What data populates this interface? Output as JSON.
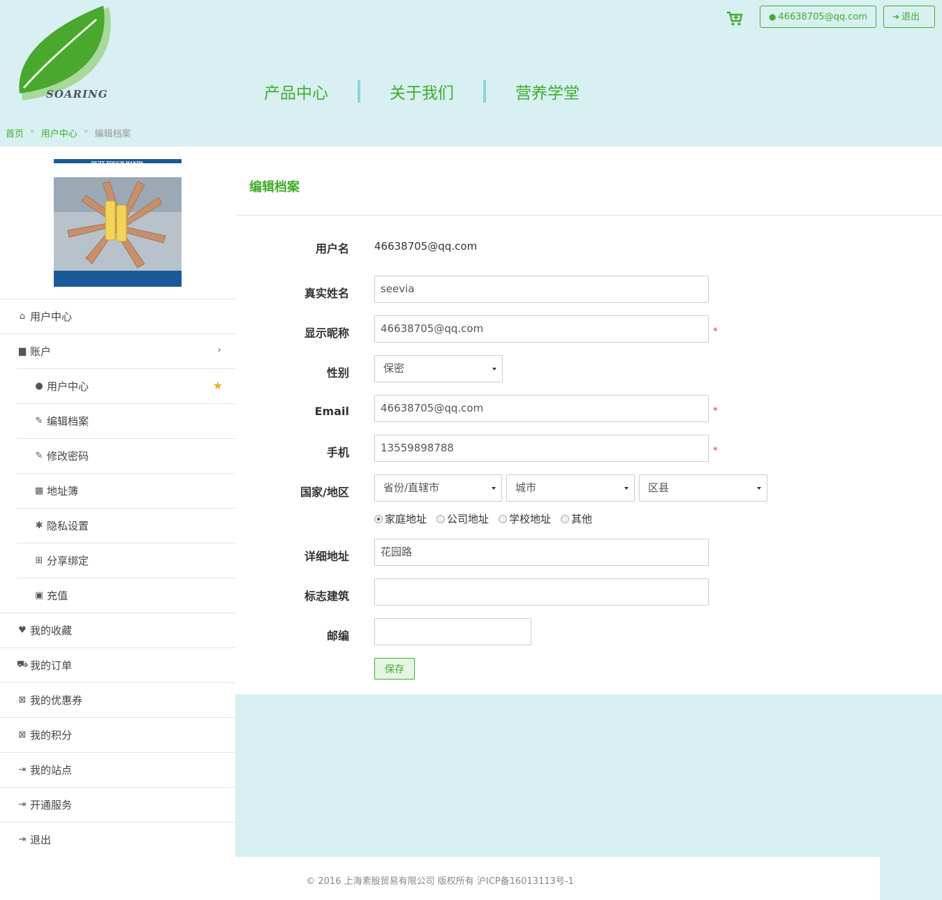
{
  "header": {
    "logo_text": "SOARING",
    "user_button": "46638705@qq.com",
    "logout_button": "退出",
    "nav": [
      "产品中心",
      "关于我们",
      "营养学堂"
    ]
  },
  "breadcrumb": {
    "home": "首页",
    "user_center": "用户中心",
    "current": "编辑档案",
    "separator": "»"
  },
  "promo": {
    "banner_text": "DUTT TOUGH HANDS"
  },
  "sidebar": {
    "items": [
      {
        "label": "用户中心",
        "icon": "home-icon",
        "glyph": "⌂"
      },
      {
        "label": "账户",
        "icon": "file-icon",
        "glyph": "▆"
      },
      {
        "label": "用户中心",
        "icon": "user-icon",
        "glyph": "●"
      },
      {
        "label": "编辑档案",
        "icon": "edit-icon",
        "glyph": "✎"
      },
      {
        "label": "修改密码",
        "icon": "edit-icon",
        "glyph": "✎"
      },
      {
        "label": "地址簿",
        "icon": "grid-icon",
        "glyph": "▦"
      },
      {
        "label": "隐私设置",
        "icon": "bug-icon",
        "glyph": "✱"
      },
      {
        "label": "分享绑定",
        "icon": "share-icon",
        "glyph": "⊞"
      },
      {
        "label": "充值",
        "icon": "money-icon",
        "glyph": "▣"
      },
      {
        "label": "我的收藏",
        "icon": "heart-icon",
        "glyph": "♥"
      },
      {
        "label": "我的订单",
        "icon": "cart-icon",
        "glyph": "⛟"
      },
      {
        "label": "我的优惠券",
        "icon": "gift-icon",
        "glyph": "⊠"
      },
      {
        "label": "我的积分",
        "icon": "gift-icon",
        "glyph": "⊠"
      },
      {
        "label": "我的站点",
        "icon": "sign-out-icon",
        "glyph": "⇥"
      },
      {
        "label": "开通服务",
        "icon": "sign-out-icon",
        "glyph": "⇥"
      },
      {
        "label": "退出",
        "icon": "sign-out-icon",
        "glyph": "⇥"
      }
    ]
  },
  "form": {
    "title": "编辑档案",
    "username_label": "用户名",
    "username_value": "46638705@qq.com",
    "realname_label": "真实姓名",
    "realname_value": "seevia",
    "nickname_label": "显示昵称",
    "nickname_value": "46638705@qq.com",
    "gender_label": "性别",
    "gender_value": "保密",
    "email_label": "Email",
    "email_value": "46638705@qq.com",
    "phone_label": "手机",
    "phone_value": "13559898788",
    "region_label": "国家/地区",
    "province": "省份/直辖市",
    "city": "城市",
    "district": "区县",
    "address_types": [
      "家庭地址",
      "公司地址",
      "学校地址",
      "其他"
    ],
    "address_label": "详细地址",
    "address_value": "花园路",
    "landmark_label": "标志建筑",
    "landmark_value": "",
    "zip_label": "邮编",
    "zip_value": "",
    "required_mark": "*",
    "save_label": "保存"
  },
  "footer": {
    "text": "© 2016 上海素殷贸易有限公司 版权所有 沪ICP备16013113号-1"
  },
  "colors": {
    "accent": "#3fae2a",
    "page_bg": "#d8f0f2",
    "nav_separator": "#8fd2dd",
    "star": "#f0a820",
    "required": "#e03030"
  }
}
